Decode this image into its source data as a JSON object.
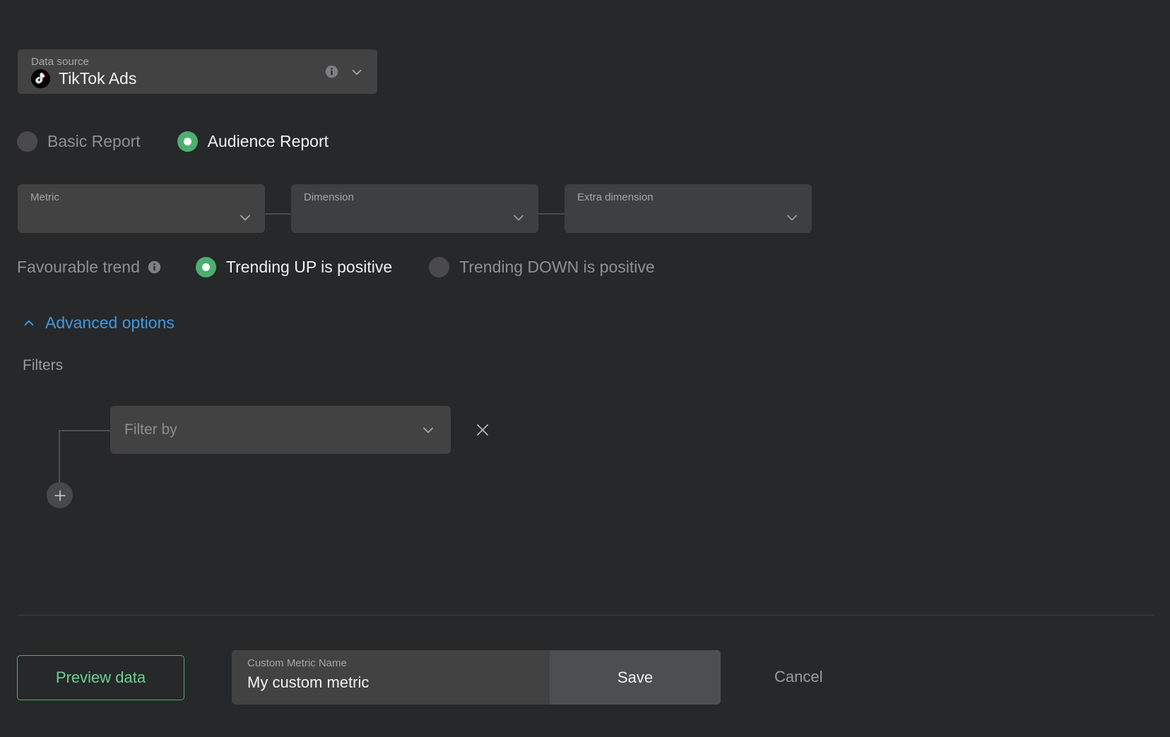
{
  "data_source": {
    "label": "Data source",
    "value": "TikTok Ads",
    "icon": "tiktok-icon",
    "info_icon": "info-icon",
    "chevron_icon": "chevron-down-icon"
  },
  "report_type": {
    "options": [
      {
        "label": "Basic Report",
        "selected": false
      },
      {
        "label": "Audience Report",
        "selected": true
      }
    ]
  },
  "selects": {
    "metric": {
      "label": "Metric",
      "value": "",
      "chevron_icon": "chevron-down-icon"
    },
    "dimension": {
      "label": "Dimension",
      "value": "",
      "chevron_icon": "chevron-down-icon"
    },
    "extra_dimension": {
      "label": "Extra dimension",
      "value": "",
      "chevron_icon": "chevron-down-icon"
    }
  },
  "favourable_trend": {
    "label": "Favourable trend",
    "info_icon": "info-icon",
    "options": [
      {
        "label": "Trending UP is positive",
        "selected": true
      },
      {
        "label": "Trending DOWN is positive",
        "selected": false
      }
    ]
  },
  "advanced": {
    "label": "Advanced options",
    "chevron_icon": "chevron-up-icon",
    "expanded": true
  },
  "filters": {
    "title": "Filters",
    "rows": [
      {
        "placeholder": "Filter by",
        "value": "",
        "chevron_icon": "chevron-down-icon",
        "remove_icon": "close-icon"
      }
    ],
    "add_icon": "plus-icon"
  },
  "footer": {
    "preview_label": "Preview data",
    "metric_name_label": "Custom Metric Name",
    "metric_name_value": "My custom metric",
    "save_label": "Save",
    "cancel_label": "Cancel"
  },
  "colors": {
    "background": "#272829",
    "field": "#424243",
    "accent_green": "#4caf70",
    "accent_blue": "#3d9ae2",
    "text_primary": "#f0f0f0",
    "text_muted": "#8f9092"
  }
}
